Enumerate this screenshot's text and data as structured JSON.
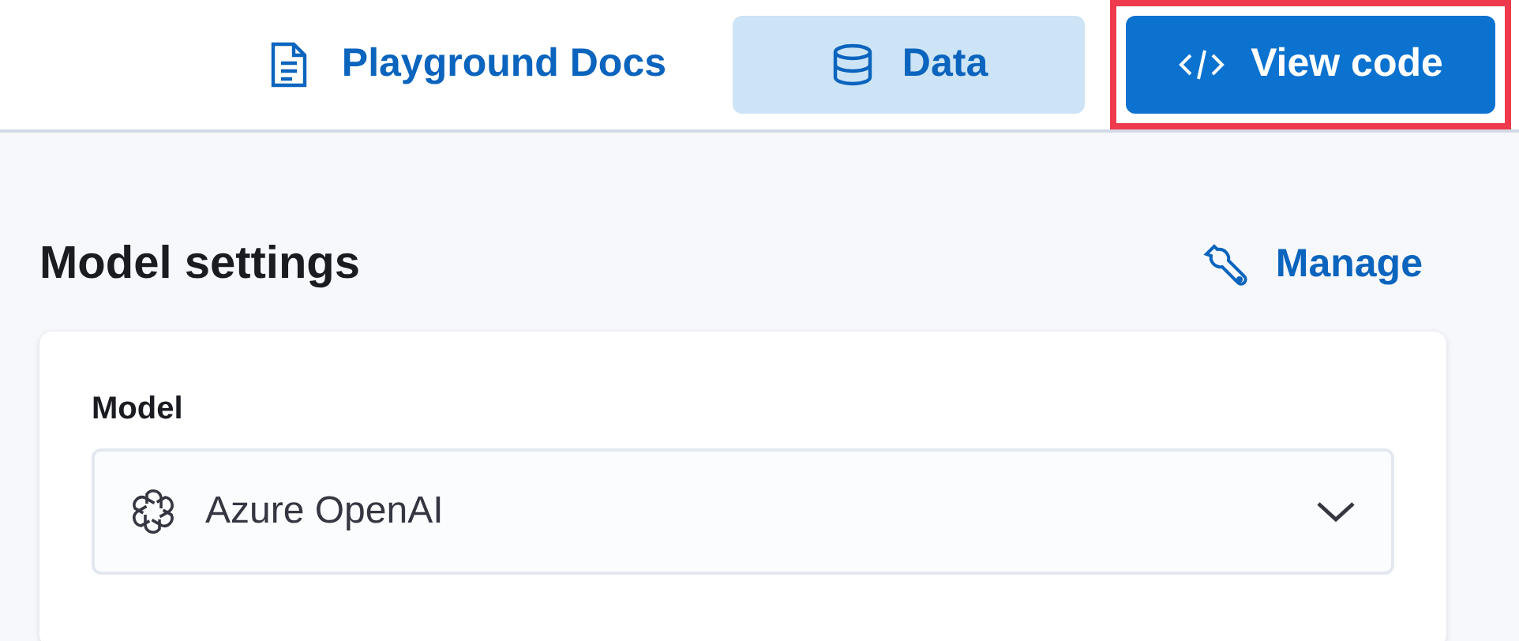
{
  "header": {
    "buttons": [
      {
        "kind": "link",
        "label": "Playground Docs",
        "highlighted": false
      },
      {
        "kind": "secondary",
        "label": "Data",
        "highlighted": false
      },
      {
        "kind": "primary",
        "label": "View code",
        "highlighted": true
      }
    ]
  },
  "model_settings": {
    "title": "Model settings",
    "manage_link": "Manage",
    "model": {
      "label": "Model",
      "value": "Azure OpenAI"
    }
  }
}
